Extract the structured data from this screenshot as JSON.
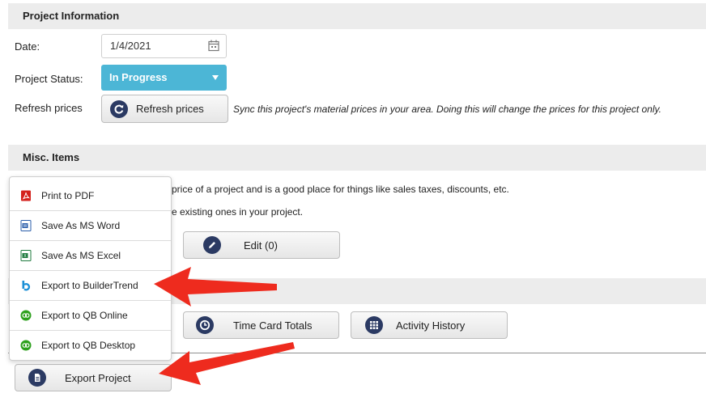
{
  "project_info": {
    "title": "Project Information",
    "date_label": "Date:",
    "date_value": "1/4/2021",
    "status_label": "Project Status:",
    "status_value": "In Progress",
    "refresh_label": "Refresh prices",
    "refresh_button": "Refresh prices",
    "sync_note": "Sync this project's material prices in your area. Doing this will change the prices for this project only."
  },
  "misc": {
    "title": "Misc. Items",
    "desc_line1": "price of a project and is a good place for things like sales taxes, discounts, etc.",
    "desc_line2": "e existing ones in your project.",
    "edit_button": "Edit (0)"
  },
  "actions": {
    "time_card_button": "Time Card Totals",
    "activity_history_button": "Activity History",
    "export_project_button": "Export Project"
  },
  "export_menu": {
    "items": [
      {
        "label": "Print to PDF",
        "icon": "pdf-icon"
      },
      {
        "label": "Save As MS Word",
        "icon": "word-icon"
      },
      {
        "label": "Save As MS Excel",
        "icon": "excel-icon"
      },
      {
        "label": "Export to BuilderTrend",
        "icon": "buildertrend-icon"
      },
      {
        "label": "Export to QB Online",
        "icon": "quickbooks-icon"
      },
      {
        "label": "Export to QB Desktop",
        "icon": "quickbooks-icon"
      }
    ]
  },
  "colors": {
    "status_select": "#4cb6d6",
    "icon_navy": "#2b3a63",
    "arrow_red": "#ee2b1e",
    "header_bg": "#ececec"
  }
}
